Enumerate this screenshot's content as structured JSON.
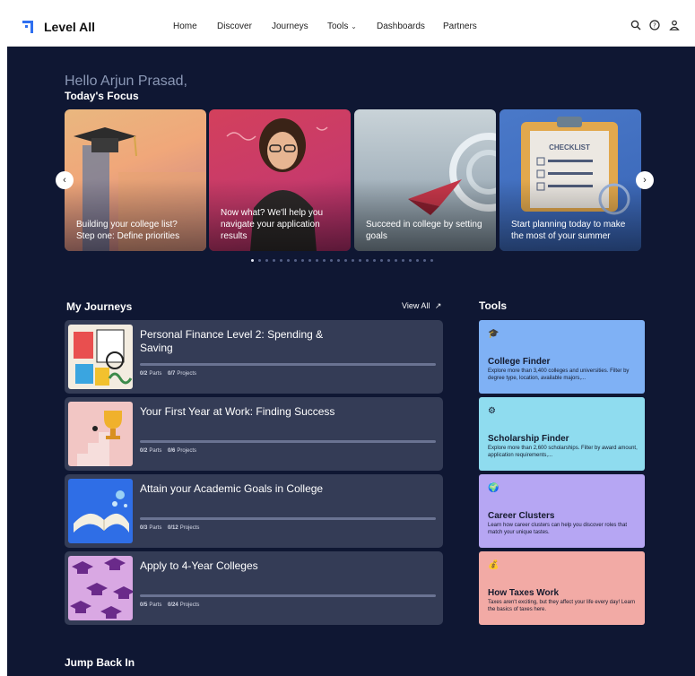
{
  "header": {
    "brand": "Level All",
    "nav": [
      "Home",
      "Discover",
      "Journeys",
      "Tools",
      "Dashboards",
      "Partners"
    ],
    "tools_chevron": "⌄",
    "icons": [
      "search-icon",
      "help-icon",
      "user-icon"
    ]
  },
  "greeting": {
    "hello": "Hello Arjun Prasad,",
    "focus": "Today's Focus"
  },
  "carousel": {
    "cards": [
      {
        "caption": "Building your college list? Step one: Define priorities"
      },
      {
        "caption": "Now what? We'll help you navigate your application results"
      },
      {
        "caption": "Succeed in college by setting goals"
      },
      {
        "caption": "Start planning today to make the most of your summer"
      }
    ],
    "checklist_label": "CHECKLIST",
    "active_dot": 0,
    "dot_count": 26
  },
  "journeys": {
    "title": "My Journeys",
    "view_all": "View All",
    "items": [
      {
        "title": "Personal Finance Level 2: Spending & Saving",
        "parts": "0/2",
        "parts_label": "Parts",
        "projects": "0/7",
        "projects_label": "Projects"
      },
      {
        "title": "Your First Year at Work: Finding Success",
        "parts": "0/2",
        "parts_label": "Parts",
        "projects": "0/6",
        "projects_label": "Projects"
      },
      {
        "title": "Attain your Academic Goals in College",
        "parts": "0/3",
        "parts_label": "Parts",
        "projects": "0/12",
        "projects_label": "Projects"
      },
      {
        "title": "Apply to 4-Year Colleges",
        "parts": "0/5",
        "parts_label": "Parts",
        "projects": "0/24",
        "projects_label": "Projects"
      }
    ]
  },
  "tools": {
    "title": "Tools",
    "items": [
      {
        "name": "College Finder",
        "desc": "Explore more than 3,400 colleges and universities. Filter by degree type, location, available majors,...",
        "icon": "graduation-cap-icon",
        "color": "#7fb1f5"
      },
      {
        "name": "Scholarship Finder",
        "desc": "Explore more than 2,600 scholarships. Filter by award amount, application requirements,...",
        "icon": "scholarship-icon",
        "color": "#8fdcef"
      },
      {
        "name": "Career Clusters",
        "desc": "Learn how career clusters can help you discover roles that match your unique tastes.",
        "icon": "globe-icon",
        "color": "#b6a6f3"
      },
      {
        "name": "How Taxes Work",
        "desc": "Taxes aren't exciting, but they affect your life every day! Learn the basics of taxes here.",
        "icon": "money-bag-icon",
        "color": "#f2aaa5"
      }
    ]
  },
  "jump_back": {
    "title": "Jump Back In"
  }
}
